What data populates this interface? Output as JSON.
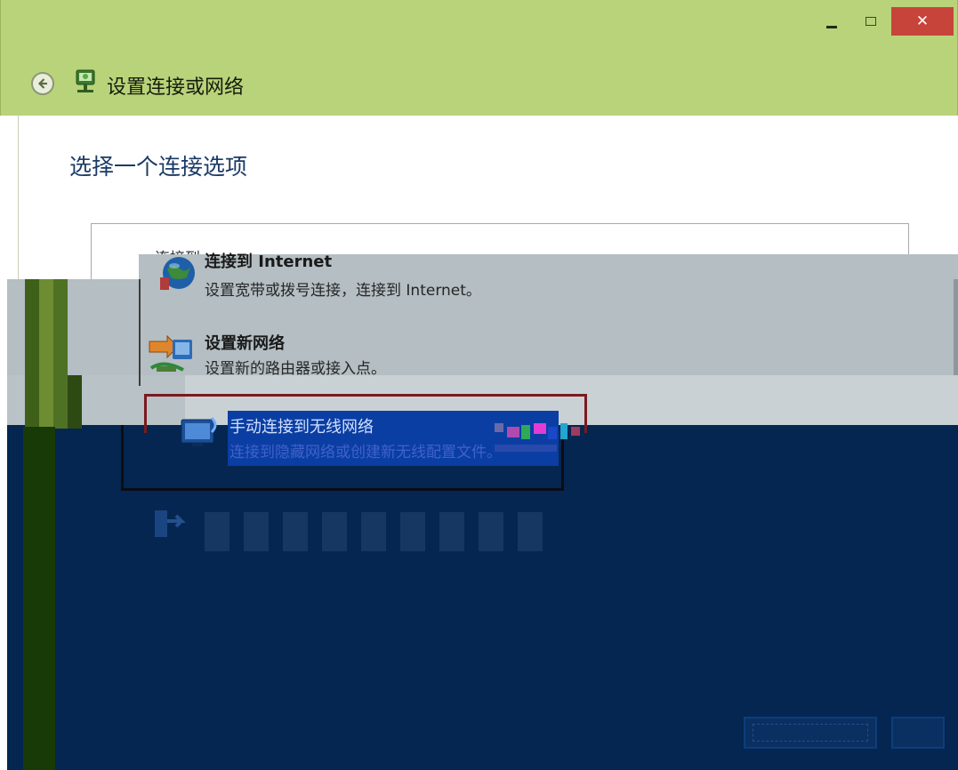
{
  "window": {
    "title": "设置连接或网络",
    "controls": {
      "minimize": "-",
      "maximize": "□",
      "close": "✕"
    }
  },
  "header": {
    "heading": "选择一个连接选项",
    "partial_label": "连接到"
  },
  "options": [
    {
      "title": "连接到 Internet",
      "description": "设置宽带或拨号连接，连接到 Internet。",
      "icon": "globe-network-icon"
    },
    {
      "title": "设置新网络",
      "description": "设置新的路由器或接入点。",
      "icon": "router-setup-icon"
    },
    {
      "title": "手动连接到无线网络",
      "description": "连接到隐藏网络或创建新无线配置文件。",
      "icon": "wireless-network-icon",
      "selected": true
    },
    {
      "title": "",
      "description": "",
      "icon": "workplace-connection-icon"
    }
  ],
  "colors": {
    "titlebar": "#b9d37a",
    "close_button": "#c7443b",
    "heading_text": "#1a3a66",
    "selection_border": "#7a1a1f",
    "selected_highlight": "#0b3ea3",
    "glitch_navy": "#042650",
    "glitch_grey": "#b4bec3"
  }
}
